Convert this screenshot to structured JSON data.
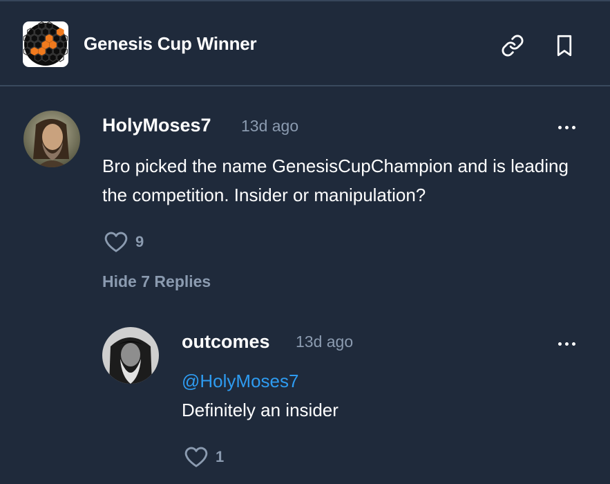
{
  "market": {
    "title": "Genesis Cup Winner"
  },
  "colors": {
    "background": "#1f2a3b",
    "mention": "#2e9bf0",
    "muted": "#8b9bb0",
    "logo_accent": "#f07a1e"
  },
  "icons": {
    "link": "link-icon",
    "bookmark": "bookmark-icon",
    "more": "more-horizontal-icon",
    "like": "heart-icon"
  },
  "comment": {
    "username": "HolyMoses7",
    "timestamp": "13d ago",
    "text": "Bro picked the name GenesisCupChampion and is leading the competition. Insider or manipulation?",
    "likes": "9",
    "toggle_replies": "Hide 7 Replies"
  },
  "reply": {
    "username": "outcomes",
    "timestamp": "13d ago",
    "mention": "@HolyMoses7",
    "text": "Definitely an insider",
    "likes": "1"
  }
}
